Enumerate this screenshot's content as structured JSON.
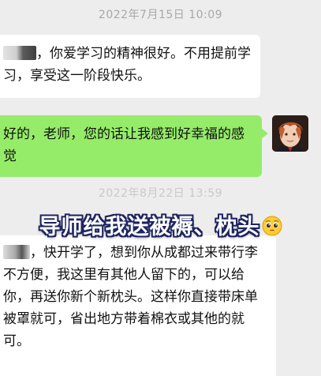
{
  "chat": {
    "timestamp_1": "2022年7月15日 10:09",
    "timestamp_2": "2022年8月22日 13:59",
    "messages": [
      {
        "from": "teacher",
        "text_after_name": "，你爱学习的精神很好。不用提前学习，享受这一阶段快乐。"
      },
      {
        "from": "student",
        "text": "好的，老师，您的话让我感到好幸福的感觉"
      },
      {
        "from": "teacher",
        "text_after_name": "，快开学了，想到你从成都过来带行李不方便，我这里有其他人留下的，可以给你，再送你新个新枕头。这样你直接带床单被罩就可，省出地方带着棉衣或其他的就可。"
      }
    ]
  },
  "overlay": {
    "caption": "导师给我送被褥、枕头",
    "emoji": "pleading-face"
  },
  "colors": {
    "background": "#ededed",
    "incoming_bubble": "#ffffff",
    "outgoing_bubble": "#95ec69",
    "caption_outline": "#1e2460"
  }
}
